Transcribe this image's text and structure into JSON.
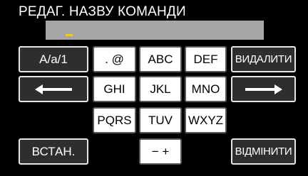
{
  "title": "РЕДАГ. НАЗВУ КОМАНДИ",
  "input": {
    "value": ""
  },
  "keys": {
    "mode": "A/a/1",
    "punct": ". @",
    "abc": "ABC",
    "def": "DEF",
    "delete": "ВИДАЛИТИ",
    "ghi": "GHI",
    "jkl": "JKL",
    "mno": "MNO",
    "pqrs": "PQRS",
    "tuv": "TUV",
    "wxyz": "WXYZ",
    "set": "ВСТАН.",
    "minus_plus": "− +",
    "cancel": "ВІДМІНИТИ"
  },
  "icons": {
    "left": "arrow-left-icon",
    "right": "arrow-right-icon"
  },
  "colors": {
    "background": "#000000",
    "input_field": "#a6a6a6",
    "cursor": "#f2d000",
    "key_light": "#ffffff",
    "key_dark": "#2e2e2e"
  }
}
